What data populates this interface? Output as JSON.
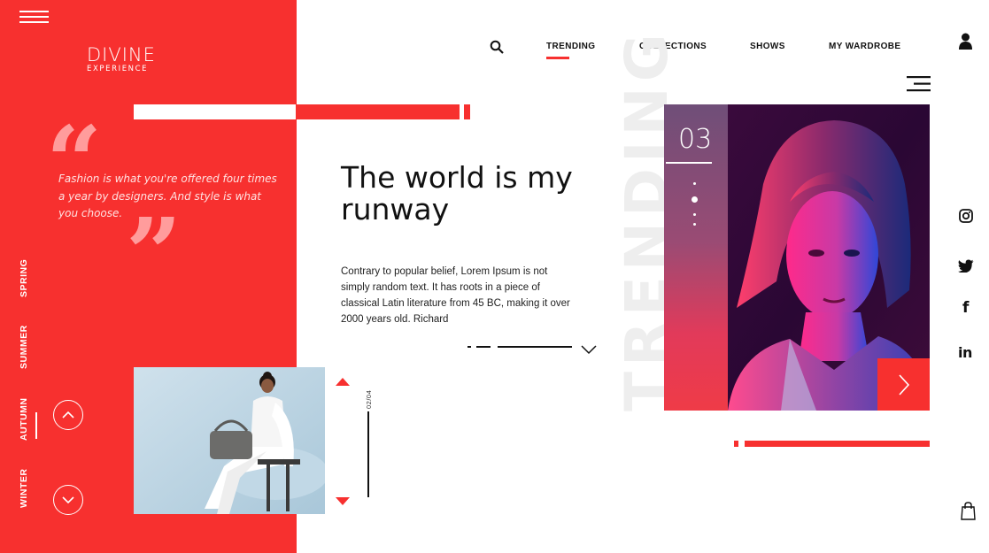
{
  "brand": {
    "title": "DIVINE",
    "subtitle": "EXPERIENCE"
  },
  "quote": {
    "text": "Fashion is what you're offered four times a year by designers. And style is what you choose."
  },
  "seasons": [
    {
      "label": "SPRING",
      "active": false
    },
    {
      "label": "SUMMER",
      "active": false
    },
    {
      "label": "AUTUMN",
      "active": true
    },
    {
      "label": "WINTER",
      "active": false
    }
  ],
  "nav": {
    "items": [
      "TRENDING",
      "COLLECTIONS",
      "SHOWS",
      "MY WARDROBE"
    ],
    "active": "TRENDING"
  },
  "hero": {
    "headline": "The world is my runway",
    "body": "Contrary to popular belief, Lorem Ipsum is not simply random text. It has roots in a piece of classical Latin literature from 45 BC, making it over 2000 years old. Richard",
    "watermark": "TRENDING"
  },
  "slider": {
    "counter": "02/04",
    "featured_number": "03"
  },
  "social": [
    "instagram-icon",
    "twitter-icon",
    "facebook-icon",
    "linkedin-icon"
  ],
  "colors": {
    "accent": "#f7302f",
    "text": "#111111",
    "background": "#ffffff"
  }
}
